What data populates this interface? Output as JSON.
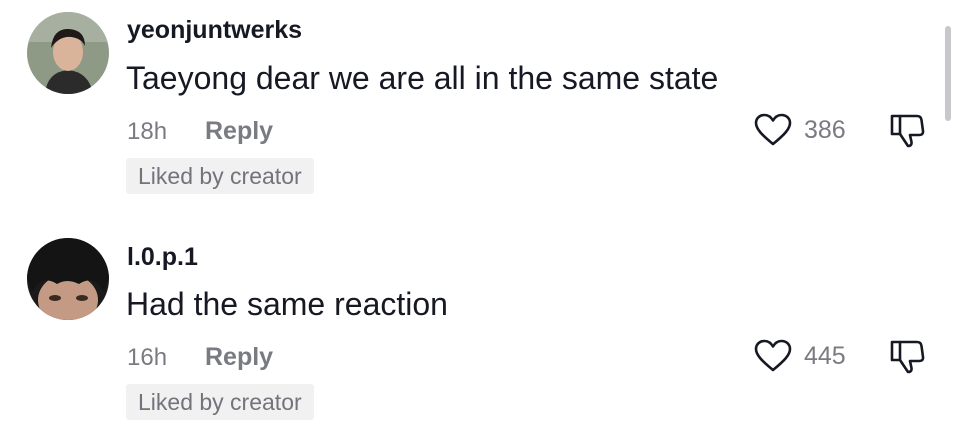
{
  "comments": [
    {
      "username": "yeonjuntwerks",
      "text": "Taeyong dear we are all in the same state",
      "time": "18h",
      "reply_label": "Reply",
      "likes": "386",
      "badge": "Liked by creator"
    },
    {
      "username": "l.0.p.1",
      "text": "Had the same reaction",
      "time": "16h",
      "reply_label": "Reply",
      "likes": "445",
      "badge": "Liked by creator"
    }
  ],
  "icons": {
    "like": "heart-outline-icon",
    "dislike": "thumbs-down-outline-icon"
  },
  "colors": {
    "text_primary": "#161823",
    "text_secondary": "#7a7b82",
    "badge_bg": "#f1f1f2"
  }
}
